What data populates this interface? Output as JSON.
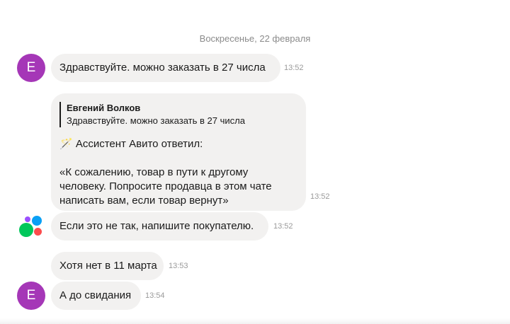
{
  "chat": {
    "date_separator": "Воскресенье, 22 февраля",
    "messages": [
      {
        "avatar_letter": "Е",
        "text": "Здравствуйте. можно заказать в 27 числа",
        "time": "13:52"
      },
      {
        "quote_author": "Евгений Волков",
        "quote_text": "Здравствуйте. можно заказать в 27 числа",
        "line1": "🪄 Ассистент Авито ответил:",
        "line2": "«К сожалению, товар в пути к другому",
        "line3": "человеку. Попросите продавца в этом чате",
        "line4": "написать вам, если товар вернут»",
        "time": "13:52"
      },
      {
        "avatar_icon": "avito-logo-icon",
        "text": "Если это не так, напишите покупателю.",
        "time": "13:52"
      },
      {
        "text": "Хотя нет в 11 марта",
        "time": "13:53"
      },
      {
        "avatar_letter": "Е",
        "text": "А до свидания",
        "time": "13:54"
      }
    ]
  },
  "colors": {
    "avatar": "#a537b7",
    "bubble": "#f2f1f0",
    "logo_blue": "#0aa0f5",
    "logo_green": "#00c75b",
    "logo_red": "#fc4c4d",
    "logo_purple": "#9b50ff"
  }
}
